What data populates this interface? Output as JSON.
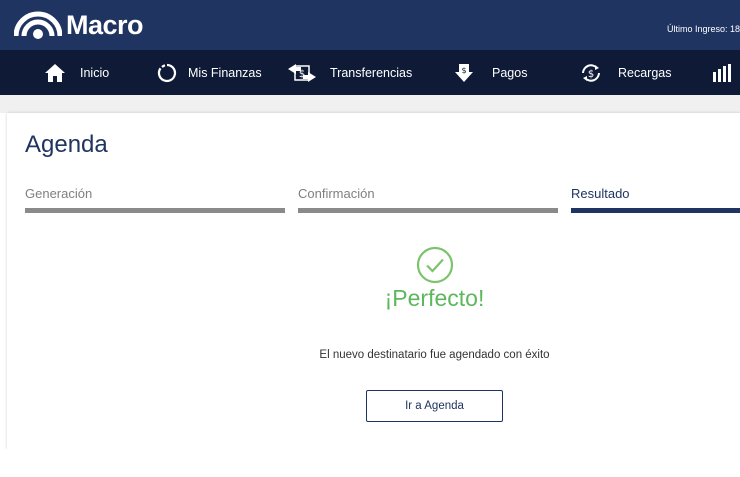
{
  "header": {
    "brand": "Macro",
    "last_login": "Último Ingreso: 18"
  },
  "nav": {
    "items": [
      {
        "label": "Inicio",
        "icon": "home-icon"
      },
      {
        "label": "Mis Finanzas",
        "icon": "finance-ring-icon"
      },
      {
        "label": "Transferencias",
        "icon": "transfer-icon"
      },
      {
        "label": "Pagos",
        "icon": "payment-down-icon"
      },
      {
        "label": "Recargas",
        "icon": "recharge-icon"
      },
      {
        "label": "",
        "icon": "chart-bars-icon"
      }
    ]
  },
  "page": {
    "title": "Agenda"
  },
  "steps": [
    {
      "label": "Generación",
      "active": false
    },
    {
      "label": "Confirmación",
      "active": false
    },
    {
      "label": "Resultado",
      "active": true
    }
  ],
  "result": {
    "icon": "check-circle-icon",
    "title": "¡Perfecto!",
    "message": "El nuevo destinatario fue agendado con éxito",
    "button_label": "Ir a Agenda"
  },
  "colors": {
    "header_bg": "#1f3461",
    "nav_bg": "#0e1a36",
    "accent": "#1f3461",
    "success": "#5cb85c"
  }
}
